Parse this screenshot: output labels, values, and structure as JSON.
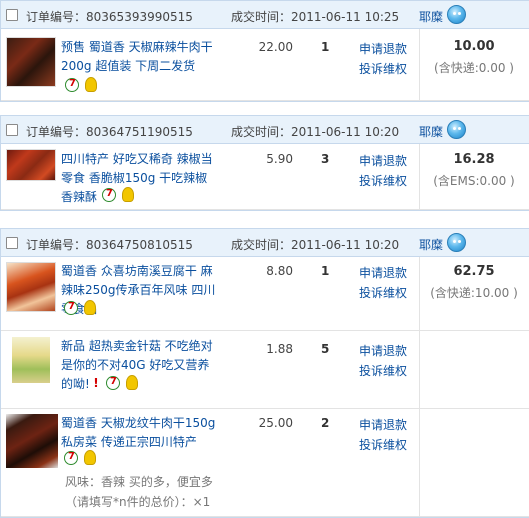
{
  "labels": {
    "order_no_prefix": "订单编号：",
    "deal_time_prefix": "成交时间：",
    "refund": "申请退款",
    "complaint": "投诉维权"
  },
  "orders": [
    {
      "order_no": "80365393990515",
      "deal_time": "2011-06-11 10:25",
      "seller": "耶糜",
      "total": "10.00",
      "shipping": "(含快递:0.00 )",
      "items": [
        {
          "title": "预售 蜀道香 天椒麻辣牛肉干200g 超值装 下周二发货",
          "price": "22.00",
          "qty": "1"
        }
      ]
    },
    {
      "order_no": "80364751190515",
      "deal_time": "2011-06-11 10:20",
      "seller": "耶糜",
      "total": "16.28",
      "shipping": "(含EMS:0.00 )",
      "items": [
        {
          "title": "四川特产 好吃又稀奇 辣椒当零食 香脆椒150g 干吃辣椒 香辣酥",
          "price": "5.90",
          "qty": "3"
        }
      ]
    },
    {
      "order_no": "80364750810515",
      "deal_time": "2011-06-11 10:20",
      "seller": "耶糜",
      "total": "62.75",
      "shipping": "(含快递:10.00 )",
      "items": [
        {
          "title": "蜀道香 众喜坊南溪豆腐干 麻辣味250g传承百年风味 四川零食品",
          "price": "8.80",
          "qty": "1"
        },
        {
          "title": "新品 超热卖金针菇 不吃绝对是你的不对40G 好吃又营养的呦!",
          "price": "1.88",
          "qty": "5"
        },
        {
          "title": "蜀道香 天椒龙纹牛肉干150g 私房菜 传递正宗四川特产",
          "price": "25.00",
          "qty": "2",
          "attr_line1": "风味：香辣 买的多，便宜多",
          "attr_line2": "（请填写*n件的总价）：×1"
        }
      ]
    }
  ],
  "colors": {
    "header_bg": "#e8f2fb",
    "link": "#0a4f9e",
    "border": "#c6d8ec"
  },
  "icons": [
    "checkbox",
    "wangwang-icon",
    "seven-day-return-icon",
    "bulb-icon",
    "exclamation-icon"
  ]
}
